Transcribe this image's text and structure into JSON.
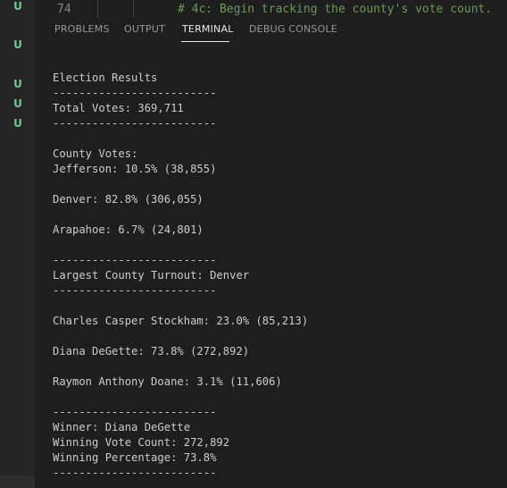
{
  "editor": {
    "line_number": "74",
    "code_comment": "# 4c: Begin tracking the county's vote count."
  },
  "scm": {
    "badges": [
      "U",
      "U",
      "U",
      "U",
      "U"
    ]
  },
  "panel": {
    "tabs": [
      {
        "label": "PROBLEMS"
      },
      {
        "label": "OUTPUT"
      },
      {
        "label": "TERMINAL"
      },
      {
        "label": "DEBUG CONSOLE"
      }
    ],
    "active_tab": "TERMINAL"
  },
  "terminal": {
    "lines": [
      "Election Results",
      "-------------------------",
      "Total Votes: 369,711",
      "-------------------------",
      "",
      "County Votes:",
      "Jefferson: 10.5% (38,855)",
      "",
      "Denver: 82.8% (306,055)",
      "",
      "Arapahoe: 6.7% (24,801)",
      "",
      "-------------------------",
      "Largest County Turnout: Denver",
      "-------------------------",
      "",
      "Charles Casper Stockham: 23.0% (85,213)",
      "",
      "Diana DeGette: 73.8% (272,892)",
      "",
      "Raymon Anthony Doane: 3.1% (11,606)",
      "",
      "-------------------------",
      "Winner: Diana DeGette",
      "Winning Vote Count: 272,892",
      "Winning Percentage: 73.8%",
      "-------------------------"
    ]
  },
  "colors": {
    "background": "#1e1e1e",
    "gutter": "#252526",
    "scm_untracked": "#73c991",
    "comment": "#6a9955",
    "text": "#cccccc"
  }
}
